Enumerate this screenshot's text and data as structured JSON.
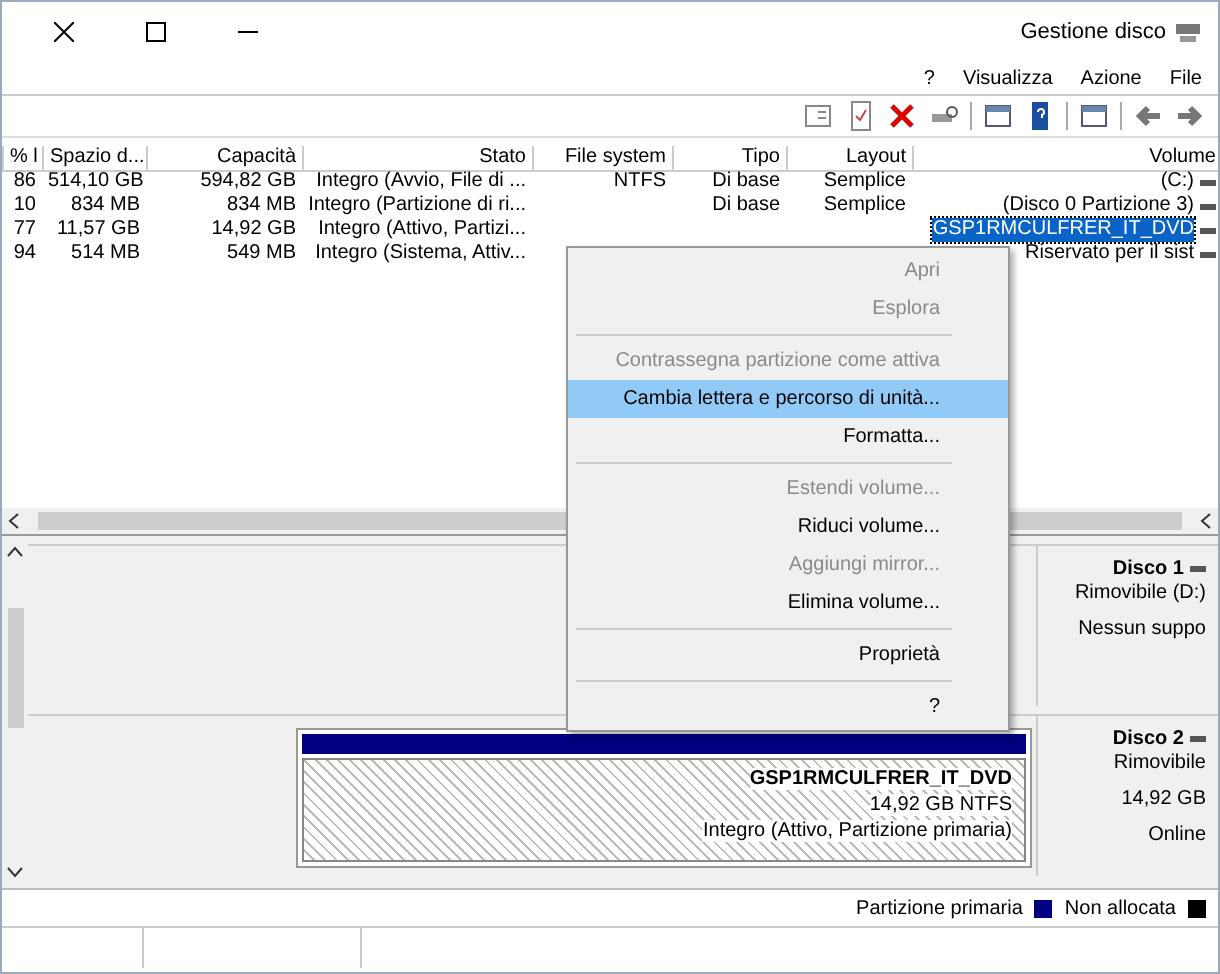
{
  "window": {
    "title": "Gestione disco"
  },
  "menu": [
    "?",
    "Visualizza",
    "Azione",
    "File"
  ],
  "table": {
    "columns": [
      "% l",
      "Spazio d...",
      "Capacità",
      "Stato",
      "File system",
      "Tipo",
      "Layout",
      "Volume"
    ],
    "rows": [
      {
        "selected": false,
        "volume": "(C:)",
        "layout": "Semplice",
        "tipo": "Di base",
        "fs": "NTFS",
        "stato": "Integro (Avvio, File di ...",
        "capacita": "594,82 GB",
        "spazio": "514,10 GB",
        "pct": "86"
      },
      {
        "selected": false,
        "volume": "(Disco 0 Partizione 3)",
        "layout": "Semplice",
        "tipo": "Di base",
        "stato": "Integro (Partizione di ri...",
        "capacita": "834 MB",
        "spazio": "834 MB",
        "pct": "10"
      },
      {
        "selected": true,
        "volume": "GSP1RMCULFRER_IT_DVD",
        "stato": "Integro (Attivo, Partizi...",
        "capacita": "14,92 GB",
        "spazio": "11,57 GB",
        "pct": "77"
      },
      {
        "selected": false,
        "volume": "Riservato per il sist",
        "stato": "Integro (Sistema, Attiv...",
        "capacita": "549 MB",
        "spazio": "514 MB",
        "pct": "94"
      }
    ]
  },
  "context_menu": [
    {
      "kind": "item",
      "label": "Apri",
      "disabled": true,
      "selected": false
    },
    {
      "kind": "item",
      "label": "Esplora",
      "disabled": true,
      "selected": false
    },
    {
      "kind": "separator"
    },
    {
      "kind": "item",
      "label": "Contrassegna partizione come attiva",
      "disabled": true,
      "selected": false
    },
    {
      "kind": "item",
      "label": "Cambia lettera e percorso di unità...",
      "disabled": false,
      "selected": true
    },
    {
      "kind": "item",
      "label": "Formatta...",
      "disabled": false,
      "selected": false
    },
    {
      "kind": "separator"
    },
    {
      "kind": "item",
      "label": "Estendi volume...",
      "disabled": true,
      "selected": false
    },
    {
      "kind": "item",
      "label": "Riduci volume...",
      "disabled": false,
      "selected": false
    },
    {
      "kind": "item",
      "label": "Aggiungi mirror...",
      "disabled": true,
      "selected": false
    },
    {
      "kind": "item",
      "label": "Elimina volume...",
      "disabled": false,
      "selected": false
    },
    {
      "kind": "separator"
    },
    {
      "kind": "item",
      "label": "Proprietà",
      "disabled": false,
      "selected": false
    },
    {
      "kind": "separator"
    },
    {
      "kind": "item",
      "label": "?",
      "disabled": false,
      "selected": false
    }
  ],
  "disks": [
    {
      "name": "Disco 1",
      "details": [
        "Rimovibile (D:)",
        "Nessun suppo"
      ]
    },
    {
      "name": "Disco 2",
      "details": [
        "Rimovibile",
        "14,92 GB",
        "Online"
      ],
      "partition": {
        "name": "GSP1RMCULFRER_IT_DVD",
        "size": "14,92 GB NTFS",
        "status": "Integro (Attivo, Partizione primaria)"
      }
    }
  ],
  "legend": [
    {
      "label": "Partizione primaria",
      "color": "#000080"
    },
    {
      "label": "Non allocata",
      "color": "#000000"
    }
  ]
}
